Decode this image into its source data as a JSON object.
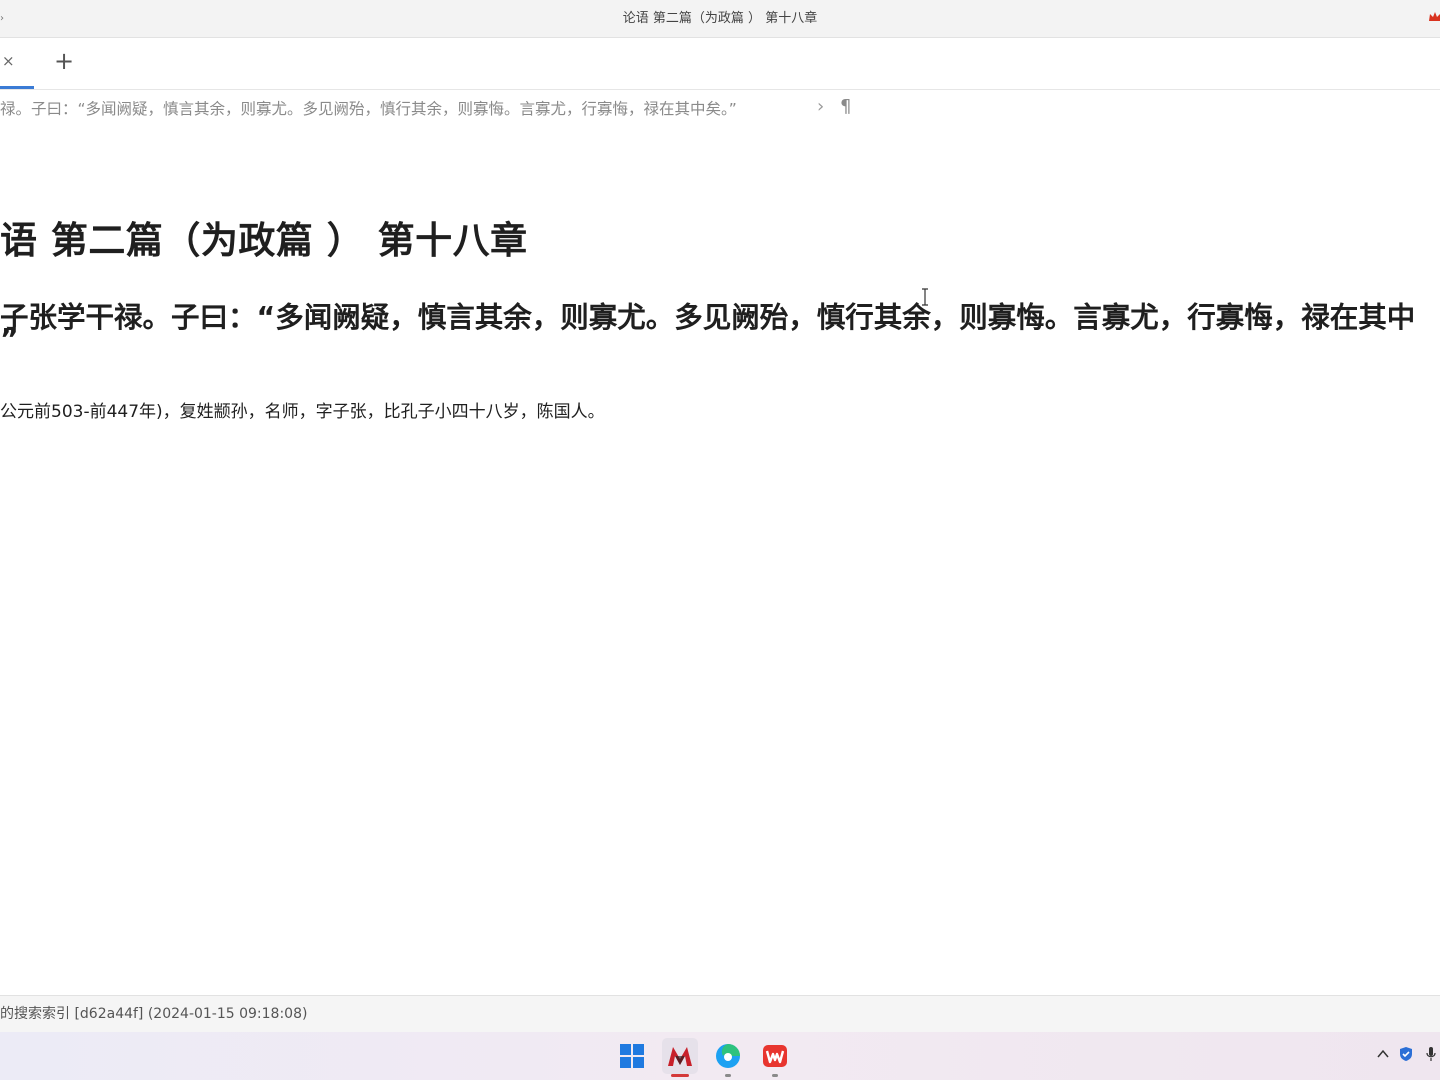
{
  "window": {
    "title": "论语 第二篇（为政篇 ） 第十八章",
    "left_edge_glyph": "›"
  },
  "tabs": {
    "active_close": "×",
    "add": "+"
  },
  "breadcrumb": {
    "text": "禄。子曰：“多闻阙疑，慎言其余，则寡尤。多见阙殆，慎行其余，则寡悔。言寡尤，行寡悔，禄在其中矣。”",
    "chevron": "›",
    "pilcrow": "¶"
  },
  "document": {
    "heading1": "语 第二篇（为政篇 ） 第十八章",
    "heading2_line1": "子张学干禄。子曰：“多闻阙疑，慎言其余，则寡尤。多见阙殆，慎行其余，则寡悔。言寡尤，行寡悔，禄在其中",
    "heading2_line2": "”",
    "paragraph": "公元前503-前447年)，复姓颛孙，名师，字子张，比孔子小四十八岁，陈国人。"
  },
  "statusbar": {
    "text": "的搜索索引 [d62a44f] (2024-01-15 09:18:08)"
  },
  "taskbar": {
    "apps": [
      "windows-start-icon",
      "app-red-m-icon",
      "edge-browser-icon",
      "wps-office-icon"
    ],
    "tray": [
      "chevron-up-icon",
      "shield-icon",
      "microphone-icon"
    ]
  },
  "colors": {
    "accent": "#3a7bd5",
    "text": "#1f1f1f",
    "muted": "#8a8a8a"
  }
}
